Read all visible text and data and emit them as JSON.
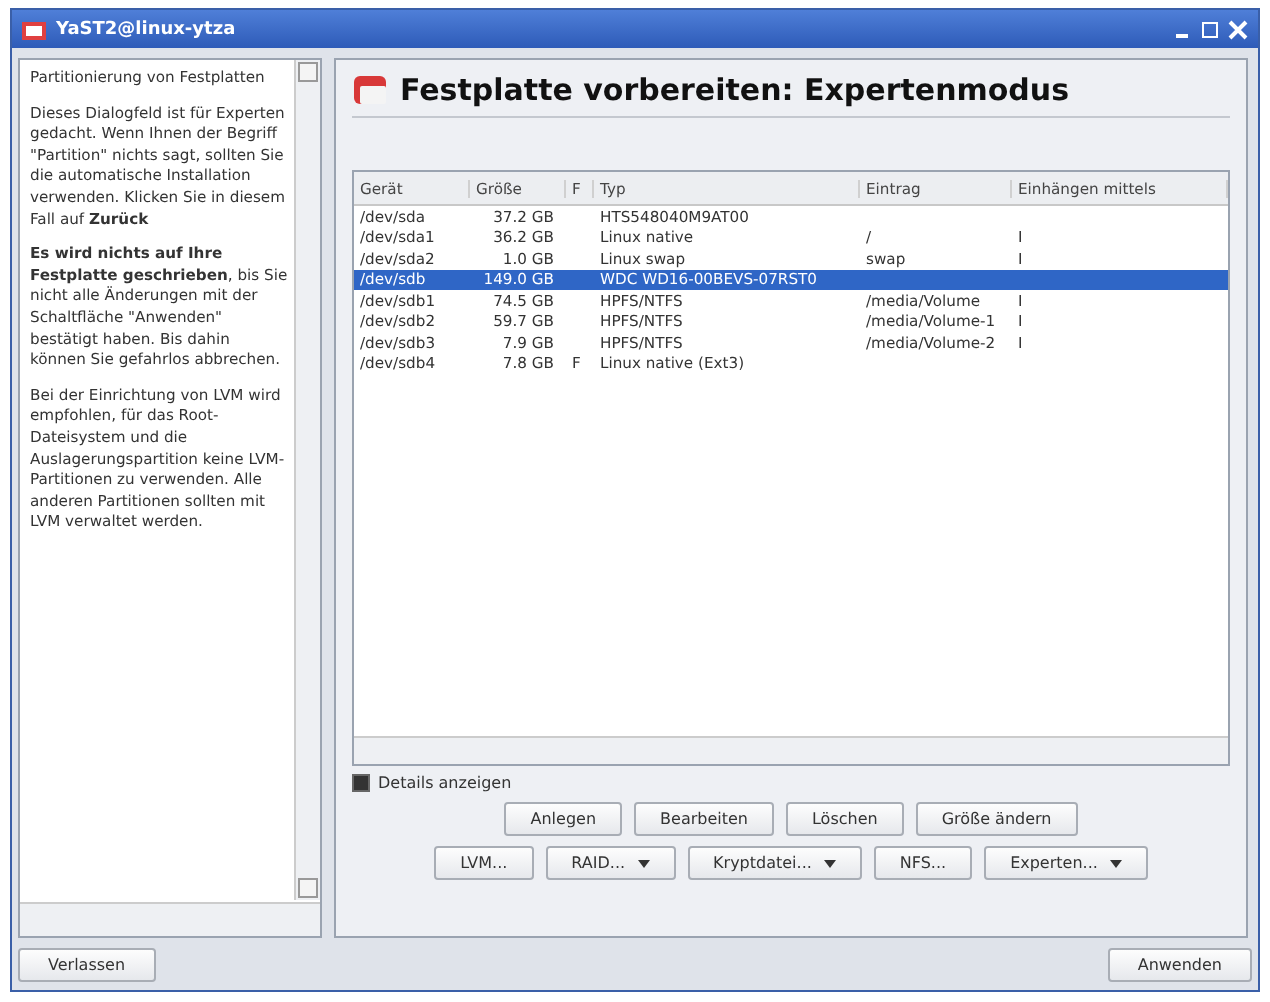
{
  "window": {
    "title": "YaST2@linux-ytza"
  },
  "help": {
    "paragraphs": [
      "Partitionierung von Festplatten",
      "Dieses Dialogfeld ist für Experten gedacht. Wenn Ihnen der Begriff \"Partition\" nichts sagt, sollten Sie die automatische Installation verwenden. Klicken Sie in diesem Fall auf **Zurück**",
      "**Es wird nichts auf Ihre Festplatte geschrieben**, bis Sie nicht alle Änderungen mit der Schaltfläche \"Anwenden\" bestätigt haben. Bis dahin können Sie gefahrlos abbrechen.",
      "Bei der Einrichtung von LVM wird empfohlen, für das Root-Dateisystem und die Auslagerungspartition keine LVM-Partitionen zu verwenden. Alle anderen Partitionen sollten mit LVM verwaltet werden."
    ]
  },
  "heading": "Festplatte vorbereiten: Expertenmodus",
  "table": {
    "columns": [
      "Gerät",
      "Größe",
      "F",
      "Typ",
      "Eintrag",
      "Einhängen mittels"
    ],
    "rows": [
      {
        "cells": [
          "/dev/sda",
          "37.2 GB",
          "",
          "HTS548040M9AT00",
          "",
          ""
        ],
        "selected": false
      },
      {
        "cells": [
          "/dev/sda1",
          "36.2 GB",
          "",
          "Linux native",
          "/",
          "I"
        ],
        "selected": false
      },
      {
        "cells": [
          "/dev/sda2",
          "1.0 GB",
          "",
          "Linux swap",
          "swap",
          "I"
        ],
        "selected": false
      },
      {
        "cells": [
          "/dev/sdb",
          "149.0 GB",
          "",
          "WDC WD16-00BEVS-07RST0",
          "",
          ""
        ],
        "selected": true
      },
      {
        "cells": [
          "/dev/sdb1",
          "74.5 GB",
          "",
          "HPFS/NTFS",
          "/media/Volume",
          "I"
        ],
        "selected": false
      },
      {
        "cells": [
          "/dev/sdb2",
          "59.7 GB",
          "",
          "HPFS/NTFS",
          "/media/Volume-1",
          "I"
        ],
        "selected": false
      },
      {
        "cells": [
          "/dev/sdb3",
          "7.9 GB",
          "",
          "HPFS/NTFS",
          "/media/Volume-2",
          "I"
        ],
        "selected": false
      },
      {
        "cells": [
          "/dev/sdb4",
          "7.8 GB",
          "F",
          "Linux native (Ext3)",
          "",
          ""
        ],
        "selected": false
      }
    ]
  },
  "details_checkbox": {
    "label": "Details anzeigen",
    "checked": true
  },
  "button_rows": [
    [
      {
        "label": "Anlegen",
        "menu": false
      },
      {
        "label": "Bearbeiten",
        "menu": false
      },
      {
        "label": "Löschen",
        "menu": false
      },
      {
        "label": "Größe ändern",
        "menu": false
      }
    ],
    [
      {
        "label": "LVM...",
        "menu": false
      },
      {
        "label": "RAID...",
        "menu": true
      },
      {
        "label": "Kryptdatei...",
        "menu": true
      },
      {
        "label": "NFS...",
        "menu": false
      },
      {
        "label": "Experten...",
        "menu": true
      }
    ]
  ],
  "footer": {
    "left": "Verlassen",
    "right": "Anwenden"
  }
}
